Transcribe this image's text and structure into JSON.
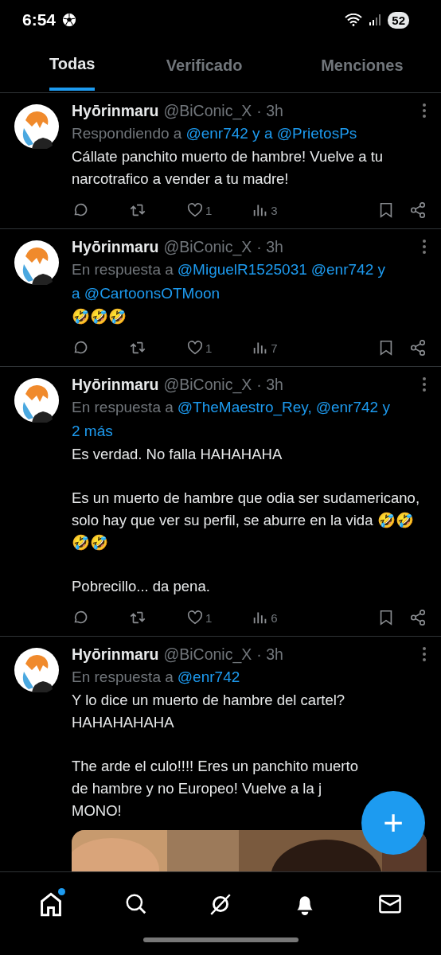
{
  "status_bar": {
    "time": "6:54",
    "battery": "52"
  },
  "tabs": [
    {
      "label": "Todas",
      "selected": true
    },
    {
      "label": "Verificado",
      "selected": false
    },
    {
      "label": "Menciones",
      "selected": false
    }
  ],
  "posts": [
    {
      "name": "Hyōrinmaru",
      "handle": "@BiConic_X",
      "time": "· 3h",
      "reply_prefix": "Respondiendo a",
      "reply_to": [
        "@enr742 y a @PrietosPs"
      ],
      "paragraphs": [
        "Cállate panchito muerto de hambre! Vuelve a tu narcotrafico a vender a tu madre!"
      ],
      "likes": "1",
      "views": "3"
    },
    {
      "name": "Hyōrinmaru",
      "handle": "@BiConic_X",
      "time": "· 3h",
      "reply_prefix": "En respuesta a",
      "reply_to": [
        "@MiguelR1525031",
        "@enr742 y",
        "a @CartoonsOTMoon"
      ],
      "paragraphs": [
        "🤣🤣🤣"
      ],
      "likes": "1",
      "views": "7"
    },
    {
      "name": "Hyōrinmaru",
      "handle": "@BiConic_X",
      "time": "· 3h",
      "reply_prefix": "En respuesta a",
      "reply_to": [
        "@TheMaestro_Rey,",
        "@enr742 y",
        "2 más"
      ],
      "paragraphs": [
        "Es verdad. No falla HAHAHAHA",
        "Es un muerto de hambre que odia ser sudamericano, solo hay que ver su perfil, se aburre en la vida 🤣🤣🤣🤣",
        "Pobrecillo... da pena."
      ],
      "likes": "1",
      "views": "6"
    },
    {
      "name": "Hyōrinmaru",
      "handle": "@BiConic_X",
      "time": "· 3h",
      "reply_prefix": "En respuesta a",
      "reply_to": [
        "@enr742"
      ],
      "paragraphs": [
        "Y lo dice un muerto de hambre del cartel?\nHAHAHAHAHA",
        "The arde el culo!!!! Eres un panchito muerto\nde hambre y no Europeo! Vuelve a la j\nMONO!"
      ],
      "media": {
        "kind": "picture"
      }
    }
  ],
  "fab": {
    "label": "+"
  },
  "nav": [
    {
      "kind": "home",
      "selected": true,
      "unread": true
    },
    {
      "kind": "search",
      "selected": false,
      "unread": false
    },
    {
      "kind": "grok",
      "selected": false,
      "unread": false
    },
    {
      "kind": "bell",
      "selected": false,
      "unread": false
    },
    {
      "kind": "mail",
      "selected": false,
      "unread": false
    }
  ]
}
